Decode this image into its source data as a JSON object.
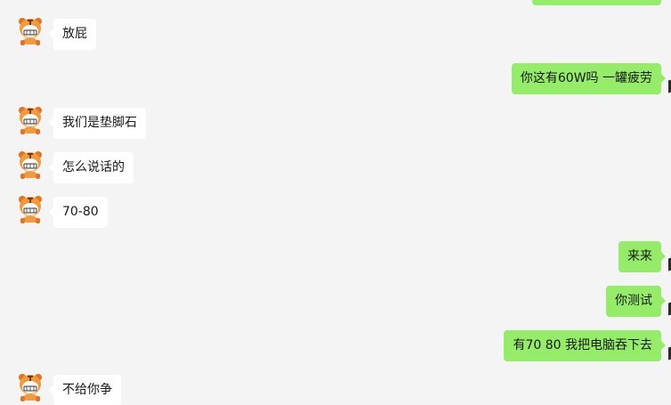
{
  "conversation": {
    "messages": [
      {
        "side": "out",
        "text": ""
      },
      {
        "side": "in",
        "text": "放屁",
        "avatar_icon": "tiger-avatar-icon"
      },
      {
        "side": "out",
        "text": "你这有60W吗 一罐疲劳"
      },
      {
        "side": "in",
        "text": "我们是垫脚石",
        "avatar_icon": "tiger-avatar-icon"
      },
      {
        "side": "in",
        "text": "怎么说话的",
        "avatar_icon": "tiger-avatar-icon"
      },
      {
        "side": "in",
        "text": "70-80",
        "avatar_icon": "tiger-avatar-icon"
      },
      {
        "side": "out",
        "text": "来来"
      },
      {
        "side": "out",
        "text": "你测试"
      },
      {
        "side": "out",
        "text": "有70 80 我把电脑吞下去"
      },
      {
        "side": "in",
        "text": "不给你争",
        "avatar_icon": "tiger-avatar-icon"
      }
    ]
  },
  "colors": {
    "background": "#f4f4f4",
    "incoming_bubble": "#ffffff",
    "outgoing_bubble": "#95ec69",
    "text": "#191919"
  }
}
